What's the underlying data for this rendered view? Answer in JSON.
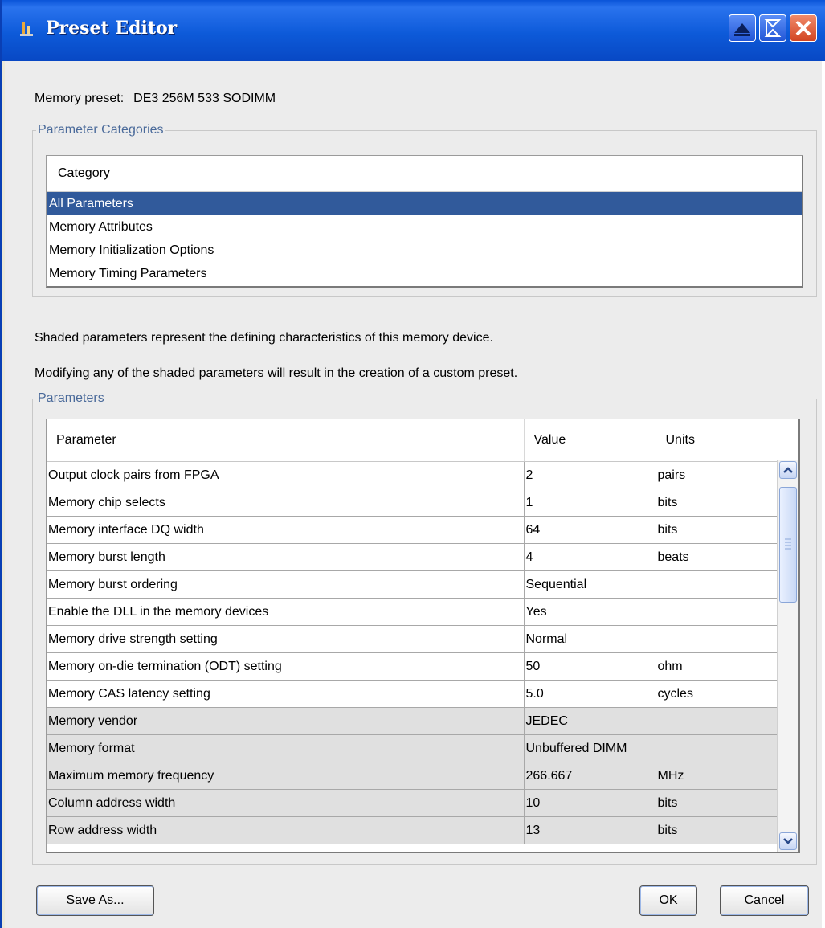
{
  "window": {
    "title": "Preset Editor"
  },
  "preset": {
    "label": "Memory preset:",
    "value": "DE3 256M 533 SODIMM"
  },
  "categories": {
    "legend": "Parameter Categories",
    "header": "Category",
    "items": [
      "All Parameters",
      "Memory Attributes",
      "Memory Initialization Options",
      "Memory Timing Parameters"
    ],
    "selected": "All Parameters"
  },
  "notes": [
    "Shaded parameters represent the defining characteristics of this memory device.",
    "Modifying any of the shaded parameters will result in the creation of a custom preset."
  ],
  "parameters": {
    "legend": "Parameters",
    "columns": [
      "Parameter",
      "Value",
      "Units"
    ],
    "rows": [
      {
        "name": "Output clock pairs from FPGA",
        "value": "2",
        "units": "pairs",
        "shaded": false
      },
      {
        "name": "Memory chip selects",
        "value": "1",
        "units": "bits",
        "shaded": false
      },
      {
        "name": "Memory interface DQ width",
        "value": "64",
        "units": "bits",
        "shaded": false
      },
      {
        "name": "Memory burst length",
        "value": "4",
        "units": "beats",
        "shaded": false
      },
      {
        "name": "Memory burst ordering",
        "value": "Sequential",
        "units": "",
        "shaded": false
      },
      {
        "name": "Enable the DLL in the memory devices",
        "value": "Yes",
        "units": "",
        "shaded": false
      },
      {
        "name": "Memory drive strength setting",
        "value": "Normal",
        "units": "",
        "shaded": false
      },
      {
        "name": "Memory on-die termination (ODT) setting",
        "value": "50",
        "units": "ohm",
        "shaded": false
      },
      {
        "name": "Memory CAS latency setting",
        "value": "5.0",
        "units": "cycles",
        "shaded": false
      },
      {
        "name": "Memory vendor",
        "value": "JEDEC",
        "units": "",
        "shaded": true
      },
      {
        "name": "Memory format",
        "value": "Unbuffered DIMM",
        "units": "",
        "shaded": true
      },
      {
        "name": "Maximum memory frequency",
        "value": "266.667",
        "units": "MHz",
        "shaded": true
      },
      {
        "name": "Column address width",
        "value": "10",
        "units": "bits",
        "shaded": true
      },
      {
        "name": "Row address width",
        "value": "13",
        "units": "bits",
        "shaded": true
      }
    ]
  },
  "buttons": {
    "save_as": "Save As...",
    "ok": "OK",
    "cancel": "Cancel"
  },
  "icons": {
    "window_icon": "java-app-icon",
    "minimize": "minimize-icon",
    "maximize": "maximize-icon",
    "close": "close-icon",
    "scroll_up": "arrow-up-icon",
    "scroll_down": "arrow-down-icon",
    "thumb_grip": "grip-icon"
  },
  "colors": {
    "titlebar": "#0d5ad9",
    "selection": "#315a9b",
    "shaded_row": "#e0e0e0",
    "legend_text": "#4a6a9a",
    "close_button": "#d24522"
  }
}
